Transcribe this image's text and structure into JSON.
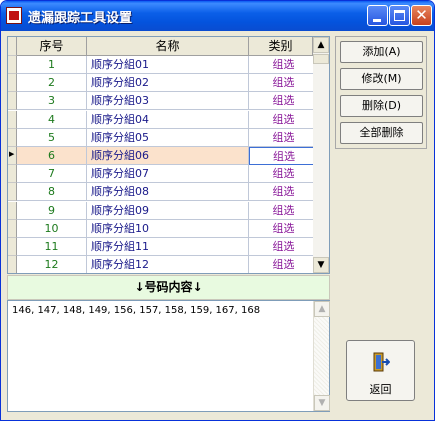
{
  "window": {
    "title": "遗漏跟踪工具设置"
  },
  "grid": {
    "columns": [
      "序号",
      "名称",
      "类别"
    ],
    "rows": [
      {
        "no": "1",
        "name": "顺序分組01",
        "type": "组选"
      },
      {
        "no": "2",
        "name": "顺序分組02",
        "type": "组选"
      },
      {
        "no": "3",
        "name": "顺序分組03",
        "type": "组选"
      },
      {
        "no": "4",
        "name": "顺序分組04",
        "type": "组选"
      },
      {
        "no": "5",
        "name": "顺序分組05",
        "type": "组选"
      },
      {
        "no": "6",
        "name": "顺序分組06",
        "type": "组选"
      },
      {
        "no": "7",
        "name": "顺序分組07",
        "type": "组选"
      },
      {
        "no": "8",
        "name": "顺序分組08",
        "type": "组选"
      },
      {
        "no": "9",
        "name": "顺序分組09",
        "type": "组选"
      },
      {
        "no": "10",
        "name": "顺序分組10",
        "type": "组选"
      },
      {
        "no": "11",
        "name": "顺序分組11",
        "type": "组选"
      },
      {
        "no": "12",
        "name": "顺序分組12",
        "type": "组选"
      }
    ],
    "selected_row_index": 5
  },
  "section_header": "↓号码内容↓",
  "content_text": "146, 147, 148, 149, 156, 157, 158, 159, 167, 168",
  "buttons": {
    "add": "添加(A)",
    "modify": "修改(M)",
    "delete": "删除(D)",
    "delete_all": "全部删除",
    "back": "返回"
  },
  "icons": {
    "app": "app-icon",
    "row_pointer": "row-pointer-icon",
    "exit": "exit-door-icon"
  }
}
